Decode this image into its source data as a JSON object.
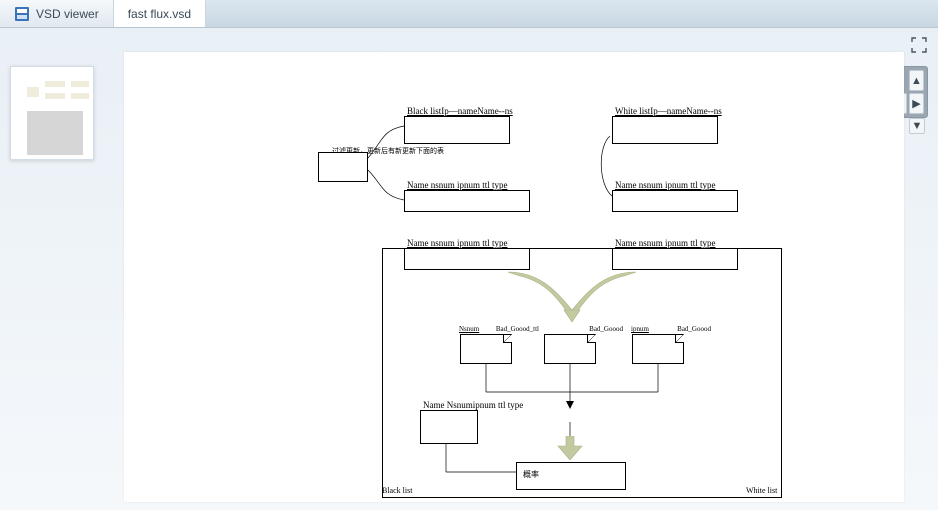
{
  "app": {
    "title": "VSD viewer",
    "file": "fast flux.vsd"
  },
  "controls": {
    "fullscreen": "fullscreen",
    "zoom_in": "+",
    "zoom_out": "−",
    "up": "▲",
    "down": "▼",
    "left": "◀",
    "right": "▶",
    "center": "✕"
  },
  "diagram": {
    "annot_left": "过滤更新，更新后有新更新下面的表",
    "box_black_list": "Black listIp—nameName--ns",
    "box_white_list": "White listIp—nameName--ns",
    "box_name_nsnum1": "Name nsnum ipnum ttl type",
    "box_name_nsnum2": "Name nsnum ipnum ttl type",
    "box_name_nsnum3": "Name nsnum ipnum ttl type",
    "box_name_nsnum4": "Name nsnum ipnum ttl type",
    "doc1_left": "Nsnum",
    "doc1_right": "Bad_Goood_ttl",
    "doc2_right": "Bad_Goood",
    "doc3_left": "ipnum",
    "doc3_right": "Bad_Goood",
    "box_name_nsnumip": "Name Nsnumipnum ttl type",
    "box_rate": "概率",
    "corner_black": "Black list",
    "corner_white": "White list"
  }
}
